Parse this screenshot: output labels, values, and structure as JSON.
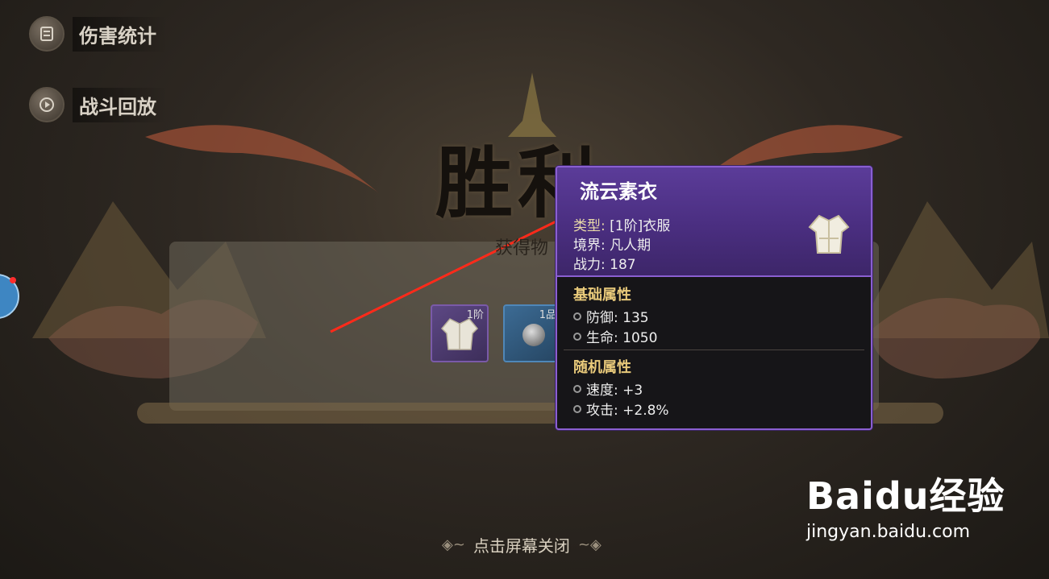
{
  "top_buttons": {
    "damage_stats": "伤害统计",
    "battle_replay": "战斗回放"
  },
  "victory": {
    "title": "胜利",
    "subtitle": "获得物"
  },
  "reward_slots": [
    {
      "tag": "1阶"
    },
    {
      "tag": "1品"
    }
  ],
  "tooltip": {
    "name": "流云素衣",
    "type_key": "类型:",
    "type_val": "[1阶]衣服",
    "realm_key": "境界:",
    "realm_val": "凡人期",
    "power_key": "战力:",
    "power_val": "187",
    "base_title": "基础属性",
    "base_attrs": [
      {
        "text": "防御: 135"
      },
      {
        "text": "生命: 1050"
      }
    ],
    "random_title": "随机属性",
    "random_attrs": [
      {
        "text": "速度: +3"
      },
      {
        "text": "攻击: +2.8%"
      }
    ],
    "border_color": "#8a5fd1",
    "header_color": "#4a2e80"
  },
  "close_hint": "点击屏幕关闭",
  "watermark": {
    "brand": "Baidu经验",
    "url": "jingyan.baidu.com"
  },
  "annotation_arrow_color": "#ff2a1a"
}
